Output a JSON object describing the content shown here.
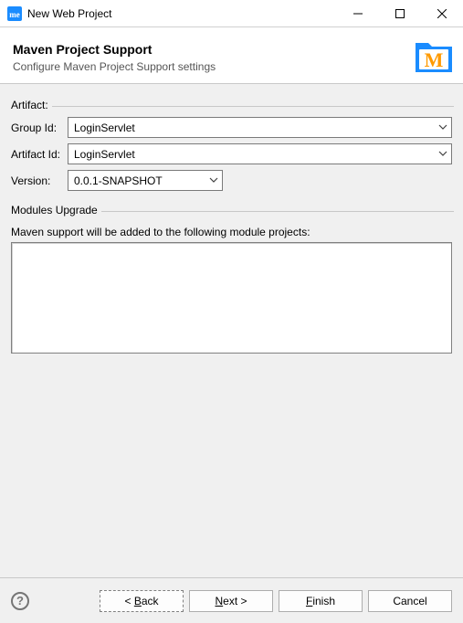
{
  "window": {
    "title": "New Web Project"
  },
  "banner": {
    "title": "Maven Project Support",
    "subtitle": "Configure Maven Project Support settings"
  },
  "artifact": {
    "section_label": "Artifact:",
    "group_id_label": "Group Id:",
    "group_id_value": "LoginServlet",
    "artifact_id_label": "Artifact Id:",
    "artifact_id_value": "LoginServlet",
    "version_label": "Version:",
    "version_value": "0.0.1-SNAPSHOT"
  },
  "modules": {
    "section_label": "Modules Upgrade",
    "note": "Maven support will be added to the following module projects:"
  },
  "footer": {
    "back": "< Back",
    "next": "Next >",
    "finish": "Finish",
    "cancel": "Cancel"
  },
  "colors": {
    "accent_blue": "#1a8cff",
    "accent_orange": "#ff9a00"
  }
}
